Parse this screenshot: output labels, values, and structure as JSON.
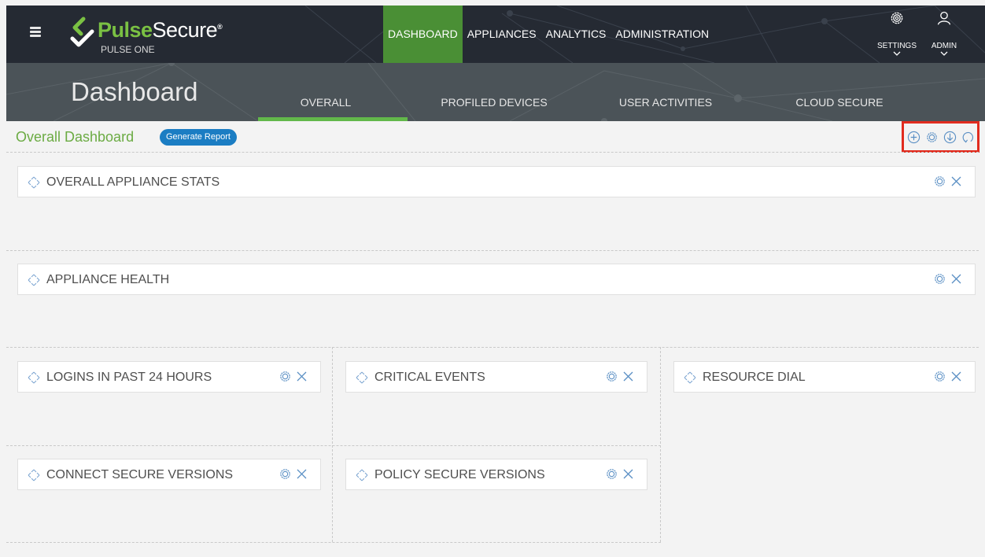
{
  "brand": {
    "name_part1": "Pulse",
    "name_part2": "Secure",
    "registered": "®",
    "product": "PULSE ONE"
  },
  "main_nav": [
    {
      "label": "DASHBOARD",
      "active": true
    },
    {
      "label": "APPLIANCES",
      "active": false
    },
    {
      "label": "ANALYTICS",
      "active": false
    },
    {
      "label": "ADMINISTRATION",
      "active": false
    }
  ],
  "utility": {
    "settings": {
      "label": "SETTINGS",
      "icon": "gear-icon"
    },
    "admin": {
      "label": "ADMIN",
      "icon": "user-icon"
    }
  },
  "page": {
    "title": "Dashboard",
    "tabs": [
      {
        "label": "OVERALL",
        "active": true
      },
      {
        "label": "PROFILED DEVICES",
        "active": false
      },
      {
        "label": "USER ACTIVITIES",
        "active": false
      },
      {
        "label": "CLOUD SECURE",
        "active": false
      }
    ]
  },
  "dashboard": {
    "title": "Overall Dashboard",
    "generate_report_label": "Generate Report",
    "toolbar_icons": [
      "add-widget-icon",
      "settings-icon",
      "download-icon",
      "refresh-icon"
    ]
  },
  "widgets": [
    {
      "title": "OVERALL APPLIANCE STATS"
    },
    {
      "title": "APPLIANCE HEALTH"
    },
    {
      "title": "LOGINS IN PAST 24 HOURS"
    },
    {
      "title": "CRITICAL EVENTS"
    },
    {
      "title": "RESOURCE DIAL"
    },
    {
      "title": "CONNECT SECURE VERSIONS"
    },
    {
      "title": "POLICY SECURE VERSIONS"
    }
  ],
  "colors": {
    "header_bg": "#252a33",
    "subheader_bg": "#4b5358",
    "active_nav": "#4a8f35",
    "brand_green": "#7ac143",
    "accent_green": "#62b84a",
    "button_blue": "#1b7dc3",
    "highlight_red": "#e12c1f",
    "icon_blue": "#5a8fc4"
  }
}
